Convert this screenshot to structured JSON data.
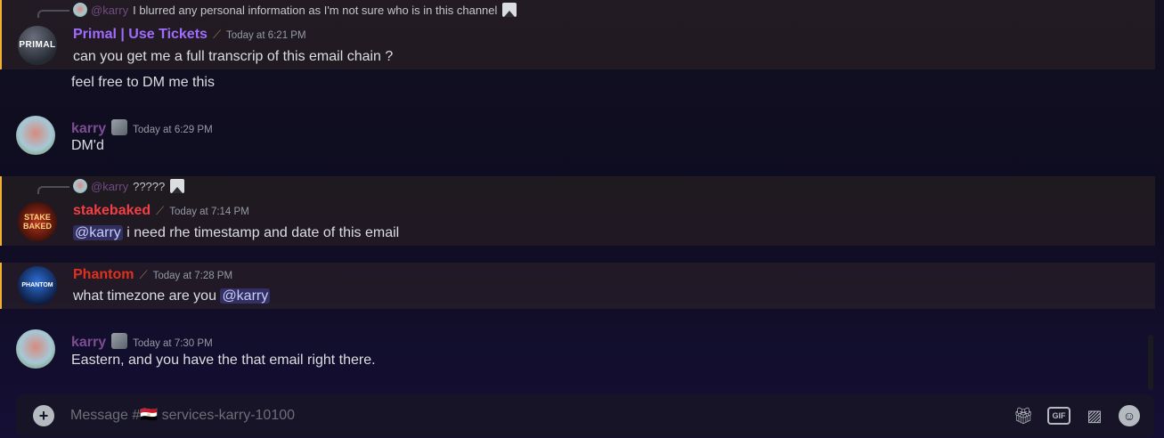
{
  "messages": [
    {
      "reply": {
        "user": "@karry",
        "text": "I blurred any personal information as I'm not sure who is in this channel"
      },
      "username": "Primal | Use Tickets",
      "username_color": "#a06bff",
      "timestamp": "Today at 6:21 PM",
      "lines": [
        "can you get me a full transcrip of this email chain ?"
      ],
      "followup": "feel free to DM me this",
      "avatar_text": "PRIMAL"
    },
    {
      "username": "karry",
      "username_color": "#7c4d92",
      "timestamp": "Today at 6:29 PM",
      "lines": [
        "DM'd"
      ]
    },
    {
      "reply": {
        "user": "@karry",
        "text": "?????"
      },
      "username": "stakebaked",
      "username_color": "#f23f43",
      "timestamp": "Today at 7:14 PM",
      "mention": "@karry",
      "lines": [
        "i need rhe timestamp and date of this email"
      ],
      "avatar_text": "STAKE BAKED"
    },
    {
      "username": "Phantom",
      "username_color": "#e0301e",
      "timestamp": "Today at 7:28 PM",
      "lines": [
        "what timezone are you"
      ],
      "mention": "@karry",
      "avatar_text": "PHANTOM"
    },
    {
      "username": "karry",
      "username_color": "#7c4d92",
      "timestamp": "Today at 7:30 PM",
      "lines": [
        "Eastern, and you have the that email right there."
      ]
    }
  ],
  "composer": {
    "placeholder": "Message #🇪🇬 services-karry-10100",
    "icons": [
      "gift-icon",
      "gif-icon",
      "sticker-icon",
      "emoji-icon"
    ],
    "gif_label": "GIF"
  }
}
